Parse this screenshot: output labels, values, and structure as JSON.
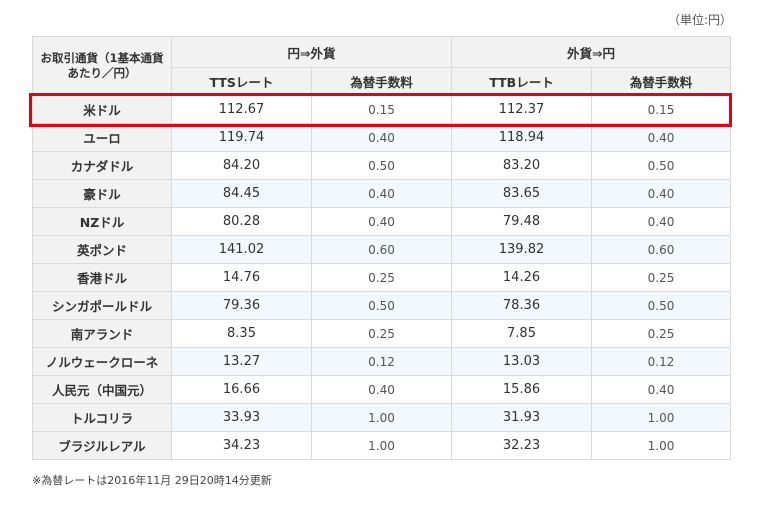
{
  "unit_label": "（単位:円）",
  "header": {
    "currency_col": "お取引通貨（1基本通貨あたり／円）",
    "group_buy": "円⇒外貨",
    "group_sell": "外貨⇒円",
    "tts": "TTSレート",
    "ttb": "TTBレート",
    "fee": "為替手数料"
  },
  "rows": [
    {
      "currency": "米ドル",
      "tts": "112.67",
      "tts_fee": "0.15",
      "ttb": "112.37",
      "ttb_fee": "0.15"
    },
    {
      "currency": "ユーロ",
      "tts": "119.74",
      "tts_fee": "0.40",
      "ttb": "118.94",
      "ttb_fee": "0.40"
    },
    {
      "currency": "カナダドル",
      "tts": "84.20",
      "tts_fee": "0.50",
      "ttb": "83.20",
      "ttb_fee": "0.50"
    },
    {
      "currency": "豪ドル",
      "tts": "84.45",
      "tts_fee": "0.40",
      "ttb": "83.65",
      "ttb_fee": "0.40"
    },
    {
      "currency": "NZドル",
      "tts": "80.28",
      "tts_fee": "0.40",
      "ttb": "79.48",
      "ttb_fee": "0.40"
    },
    {
      "currency": "英ポンド",
      "tts": "141.02",
      "tts_fee": "0.60",
      "ttb": "139.82",
      "ttb_fee": "0.60"
    },
    {
      "currency": "香港ドル",
      "tts": "14.76",
      "tts_fee": "0.25",
      "ttb": "14.26",
      "ttb_fee": "0.25"
    },
    {
      "currency": "シンガポールドル",
      "tts": "79.36",
      "tts_fee": "0.50",
      "ttb": "78.36",
      "ttb_fee": "0.50"
    },
    {
      "currency": "南アランド",
      "tts": "8.35",
      "tts_fee": "0.25",
      "ttb": "7.85",
      "ttb_fee": "0.25"
    },
    {
      "currency": "ノルウェークローネ",
      "tts": "13.27",
      "tts_fee": "0.12",
      "ttb": "13.03",
      "ttb_fee": "0.12"
    },
    {
      "currency": "人民元（中国元）",
      "tts": "16.66",
      "tts_fee": "0.40",
      "ttb": "15.86",
      "ttb_fee": "0.40"
    },
    {
      "currency": "トルコリラ",
      "tts": "33.93",
      "tts_fee": "1.00",
      "ttb": "31.93",
      "ttb_fee": "1.00"
    },
    {
      "currency": "ブラジルレアル",
      "tts": "34.23",
      "tts_fee": "1.00",
      "ttb": "32.23",
      "ttb_fee": "1.00"
    }
  ],
  "highlight_color": "#e60012",
  "header_bg": "#f2f2f2",
  "alt_row_bg": "#f3f8fc",
  "footnote": "※為替レートは2016年11月 29日20時14分更新"
}
